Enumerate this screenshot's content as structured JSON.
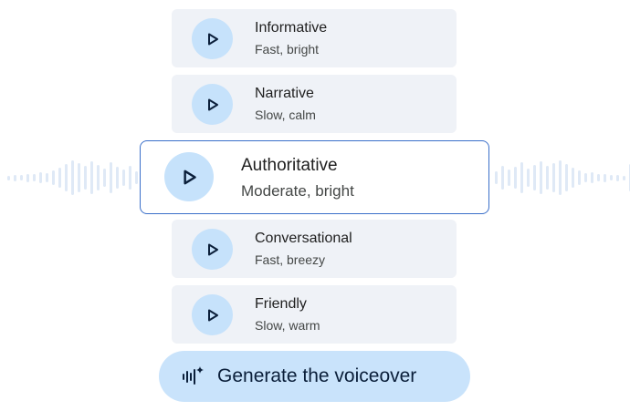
{
  "voices": [
    {
      "name": "Informative",
      "description": "Fast, bright",
      "selected": false
    },
    {
      "name": "Narrative",
      "description": "Slow, calm",
      "selected": false
    },
    {
      "name": "Authoritative",
      "description": "Moderate, bright",
      "selected": true
    },
    {
      "name": "Conversational",
      "description": "Fast, breezy",
      "selected": false
    },
    {
      "name": "Friendly",
      "description": "Slow, warm",
      "selected": false
    }
  ],
  "icons": {
    "play": "play-icon",
    "generate": "voice-sparkle-icon"
  },
  "generate_button": {
    "label": "Generate the voiceover"
  },
  "colors": {
    "card_background": "#eff2f7",
    "play_button": "#c6e2fb",
    "selected_border": "#3a6fc9",
    "generate_button": "#c9e3fb",
    "waveform": "#dfe9f6"
  }
}
